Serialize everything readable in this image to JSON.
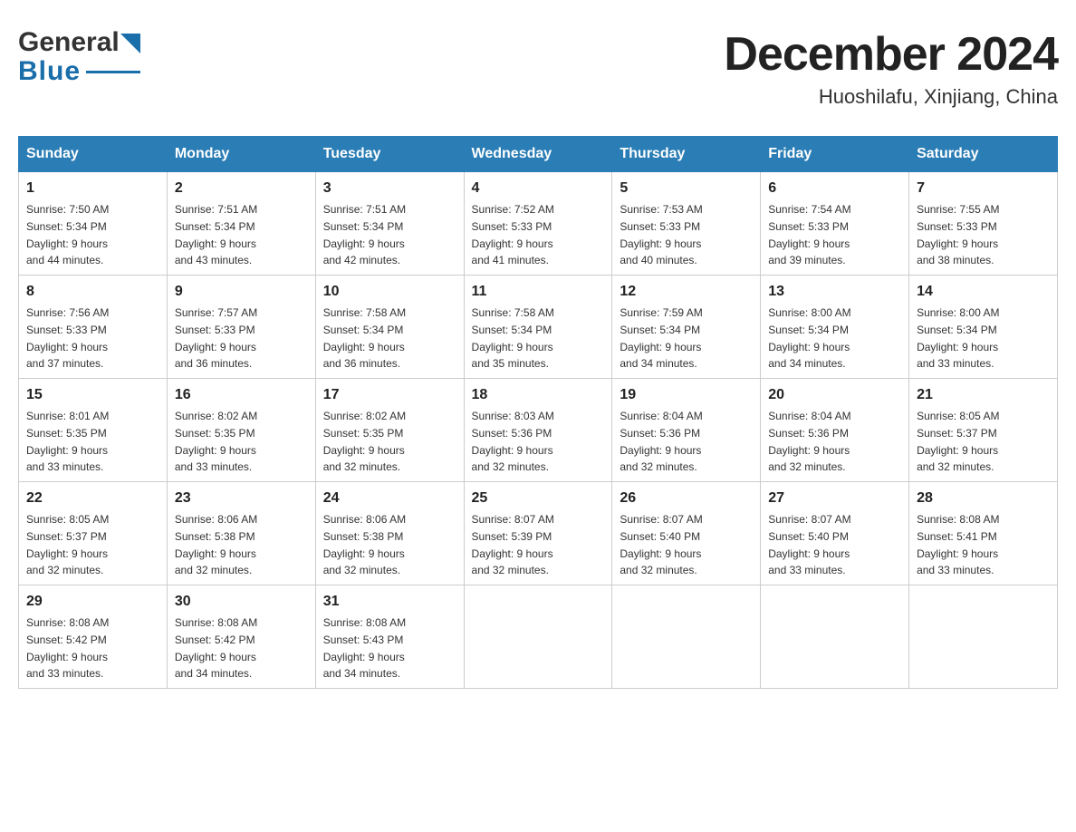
{
  "header": {
    "logo_text_general": "General",
    "logo_text_blue": "Blue",
    "month_title": "December 2024",
    "location": "Huoshilafu, Xinjiang, China"
  },
  "weekdays": [
    "Sunday",
    "Monday",
    "Tuesday",
    "Wednesday",
    "Thursday",
    "Friday",
    "Saturday"
  ],
  "weeks": [
    [
      {
        "day": "1",
        "sunrise": "Sunrise: 7:50 AM",
        "sunset": "Sunset: 5:34 PM",
        "daylight": "Daylight: 9 hours",
        "daylight2": "and 44 minutes."
      },
      {
        "day": "2",
        "sunrise": "Sunrise: 7:51 AM",
        "sunset": "Sunset: 5:34 PM",
        "daylight": "Daylight: 9 hours",
        "daylight2": "and 43 minutes."
      },
      {
        "day": "3",
        "sunrise": "Sunrise: 7:51 AM",
        "sunset": "Sunset: 5:34 PM",
        "daylight": "Daylight: 9 hours",
        "daylight2": "and 42 minutes."
      },
      {
        "day": "4",
        "sunrise": "Sunrise: 7:52 AM",
        "sunset": "Sunset: 5:33 PM",
        "daylight": "Daylight: 9 hours",
        "daylight2": "and 41 minutes."
      },
      {
        "day": "5",
        "sunrise": "Sunrise: 7:53 AM",
        "sunset": "Sunset: 5:33 PM",
        "daylight": "Daylight: 9 hours",
        "daylight2": "and 40 minutes."
      },
      {
        "day": "6",
        "sunrise": "Sunrise: 7:54 AM",
        "sunset": "Sunset: 5:33 PM",
        "daylight": "Daylight: 9 hours",
        "daylight2": "and 39 minutes."
      },
      {
        "day": "7",
        "sunrise": "Sunrise: 7:55 AM",
        "sunset": "Sunset: 5:33 PM",
        "daylight": "Daylight: 9 hours",
        "daylight2": "and 38 minutes."
      }
    ],
    [
      {
        "day": "8",
        "sunrise": "Sunrise: 7:56 AM",
        "sunset": "Sunset: 5:33 PM",
        "daylight": "Daylight: 9 hours",
        "daylight2": "and 37 minutes."
      },
      {
        "day": "9",
        "sunrise": "Sunrise: 7:57 AM",
        "sunset": "Sunset: 5:33 PM",
        "daylight": "Daylight: 9 hours",
        "daylight2": "and 36 minutes."
      },
      {
        "day": "10",
        "sunrise": "Sunrise: 7:58 AM",
        "sunset": "Sunset: 5:34 PM",
        "daylight": "Daylight: 9 hours",
        "daylight2": "and 36 minutes."
      },
      {
        "day": "11",
        "sunrise": "Sunrise: 7:58 AM",
        "sunset": "Sunset: 5:34 PM",
        "daylight": "Daylight: 9 hours",
        "daylight2": "and 35 minutes."
      },
      {
        "day": "12",
        "sunrise": "Sunrise: 7:59 AM",
        "sunset": "Sunset: 5:34 PM",
        "daylight": "Daylight: 9 hours",
        "daylight2": "and 34 minutes."
      },
      {
        "day": "13",
        "sunrise": "Sunrise: 8:00 AM",
        "sunset": "Sunset: 5:34 PM",
        "daylight": "Daylight: 9 hours",
        "daylight2": "and 34 minutes."
      },
      {
        "day": "14",
        "sunrise": "Sunrise: 8:00 AM",
        "sunset": "Sunset: 5:34 PM",
        "daylight": "Daylight: 9 hours",
        "daylight2": "and 33 minutes."
      }
    ],
    [
      {
        "day": "15",
        "sunrise": "Sunrise: 8:01 AM",
        "sunset": "Sunset: 5:35 PM",
        "daylight": "Daylight: 9 hours",
        "daylight2": "and 33 minutes."
      },
      {
        "day": "16",
        "sunrise": "Sunrise: 8:02 AM",
        "sunset": "Sunset: 5:35 PM",
        "daylight": "Daylight: 9 hours",
        "daylight2": "and 33 minutes."
      },
      {
        "day": "17",
        "sunrise": "Sunrise: 8:02 AM",
        "sunset": "Sunset: 5:35 PM",
        "daylight": "Daylight: 9 hours",
        "daylight2": "and 32 minutes."
      },
      {
        "day": "18",
        "sunrise": "Sunrise: 8:03 AM",
        "sunset": "Sunset: 5:36 PM",
        "daylight": "Daylight: 9 hours",
        "daylight2": "and 32 minutes."
      },
      {
        "day": "19",
        "sunrise": "Sunrise: 8:04 AM",
        "sunset": "Sunset: 5:36 PM",
        "daylight": "Daylight: 9 hours",
        "daylight2": "and 32 minutes."
      },
      {
        "day": "20",
        "sunrise": "Sunrise: 8:04 AM",
        "sunset": "Sunset: 5:36 PM",
        "daylight": "Daylight: 9 hours",
        "daylight2": "and 32 minutes."
      },
      {
        "day": "21",
        "sunrise": "Sunrise: 8:05 AM",
        "sunset": "Sunset: 5:37 PM",
        "daylight": "Daylight: 9 hours",
        "daylight2": "and 32 minutes."
      }
    ],
    [
      {
        "day": "22",
        "sunrise": "Sunrise: 8:05 AM",
        "sunset": "Sunset: 5:37 PM",
        "daylight": "Daylight: 9 hours",
        "daylight2": "and 32 minutes."
      },
      {
        "day": "23",
        "sunrise": "Sunrise: 8:06 AM",
        "sunset": "Sunset: 5:38 PM",
        "daylight": "Daylight: 9 hours",
        "daylight2": "and 32 minutes."
      },
      {
        "day": "24",
        "sunrise": "Sunrise: 8:06 AM",
        "sunset": "Sunset: 5:38 PM",
        "daylight": "Daylight: 9 hours",
        "daylight2": "and 32 minutes."
      },
      {
        "day": "25",
        "sunrise": "Sunrise: 8:07 AM",
        "sunset": "Sunset: 5:39 PM",
        "daylight": "Daylight: 9 hours",
        "daylight2": "and 32 minutes."
      },
      {
        "day": "26",
        "sunrise": "Sunrise: 8:07 AM",
        "sunset": "Sunset: 5:40 PM",
        "daylight": "Daylight: 9 hours",
        "daylight2": "and 32 minutes."
      },
      {
        "day": "27",
        "sunrise": "Sunrise: 8:07 AM",
        "sunset": "Sunset: 5:40 PM",
        "daylight": "Daylight: 9 hours",
        "daylight2": "and 33 minutes."
      },
      {
        "day": "28",
        "sunrise": "Sunrise: 8:08 AM",
        "sunset": "Sunset: 5:41 PM",
        "daylight": "Daylight: 9 hours",
        "daylight2": "and 33 minutes."
      }
    ],
    [
      {
        "day": "29",
        "sunrise": "Sunrise: 8:08 AM",
        "sunset": "Sunset: 5:42 PM",
        "daylight": "Daylight: 9 hours",
        "daylight2": "and 33 minutes."
      },
      {
        "day": "30",
        "sunrise": "Sunrise: 8:08 AM",
        "sunset": "Sunset: 5:42 PM",
        "daylight": "Daylight: 9 hours",
        "daylight2": "and 34 minutes."
      },
      {
        "day": "31",
        "sunrise": "Sunrise: 8:08 AM",
        "sunset": "Sunset: 5:43 PM",
        "daylight": "Daylight: 9 hours",
        "daylight2": "and 34 minutes."
      },
      null,
      null,
      null,
      null
    ]
  ]
}
